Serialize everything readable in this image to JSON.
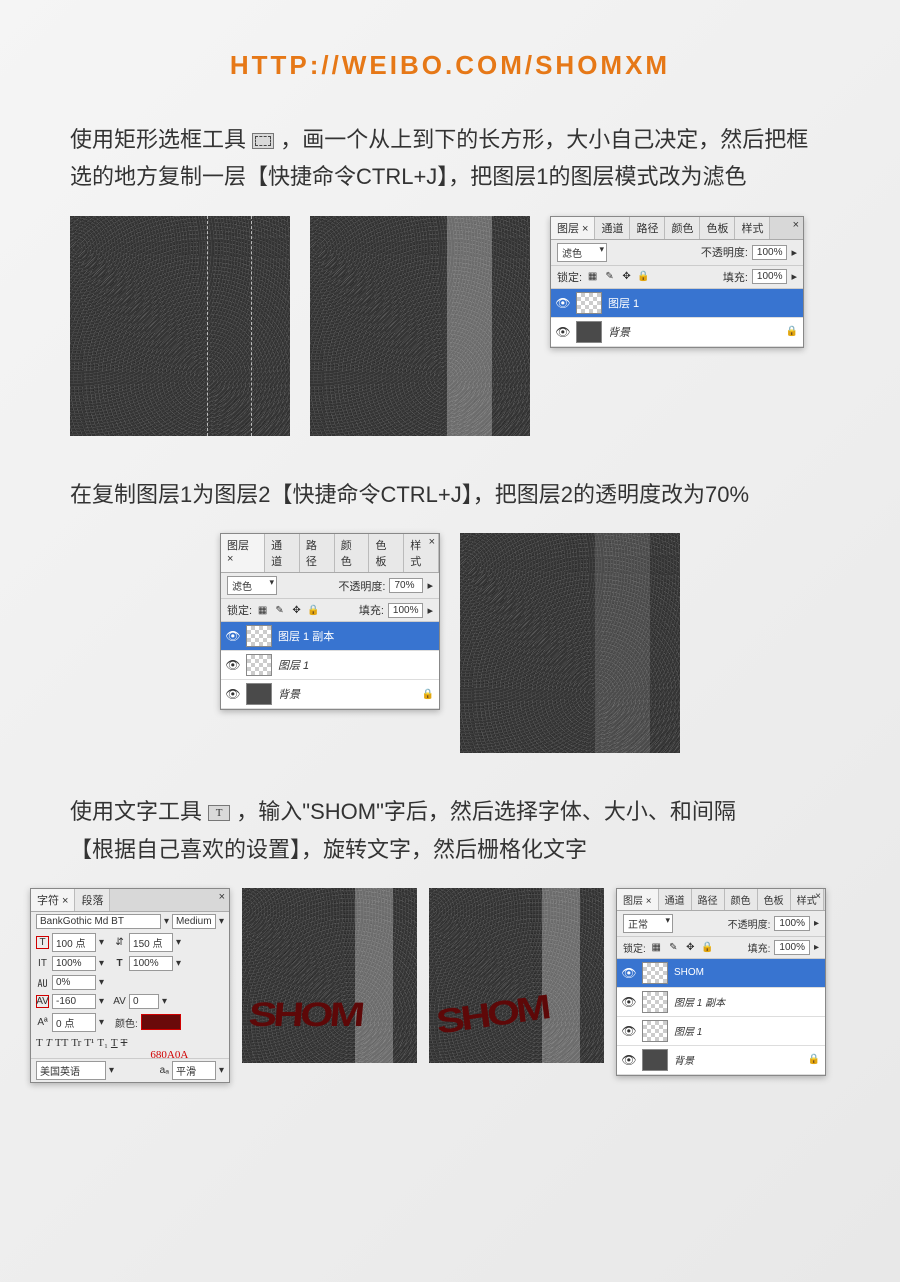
{
  "header": {
    "url": "HTTP://WEIBO.COM/SHOMXM"
  },
  "step1": {
    "text_a": "使用矩形选框工具",
    "text_b": "，画一个从上到下的长方形，大小自己决定，然后把框选的地方复制一层【快捷命令CTRL+J】，把图层1的图层模式改为滤色"
  },
  "panel1": {
    "tabs": [
      "图层 ×",
      "通道",
      "路径",
      "颜色",
      "色板",
      "样式"
    ],
    "blend": "滤色",
    "opacity_label": "不透明度:",
    "opacity_val": "100%",
    "lock_label": "锁定:",
    "fill_label": "填充:",
    "fill_val": "100%",
    "layers": [
      {
        "name": "图层 1",
        "selected": true,
        "thumb": "checker"
      },
      {
        "name": "背景",
        "locked": true,
        "thumb": "noise"
      }
    ]
  },
  "step2": {
    "text": "在复制图层1为图层2【快捷命令CTRL+J】，把图层2的透明度改为70%"
  },
  "panel2": {
    "tabs": [
      "图层 ×",
      "通道",
      "路径",
      "颜色",
      "色板",
      "样式"
    ],
    "blend": "滤色",
    "opacity_label": "不透明度:",
    "opacity_val": "70%",
    "lock_label": "锁定:",
    "fill_label": "填充:",
    "fill_val": "100%",
    "layers": [
      {
        "name": "图层 1 副本",
        "selected": true,
        "thumb": "checker"
      },
      {
        "name": "图层 1",
        "thumb": "checker"
      },
      {
        "name": "背景",
        "locked": true,
        "thumb": "noise"
      }
    ]
  },
  "step3": {
    "text_a": "使用文字工具",
    "text_b": "，输入\"SHOM\"字后，然后选择字体、大小、和间隔",
    "text_c": "【根据自己喜欢的设置】，旋转文字，然后栅格化文字"
  },
  "char_panel": {
    "tabs": [
      "字符 ×",
      "段落"
    ],
    "font": "BankGothic Md BT",
    "weight": "Medium",
    "size": "100 点",
    "leading": "150 点",
    "scale_v": "100%",
    "scale_h": "100%",
    "baseline_pct": "0%",
    "tracking": "-160",
    "baseline_shift": "0 点",
    "color_label": "颜色:",
    "color_hex": "680A0A",
    "lang": "美国英语",
    "aa": "平滑",
    "aa_prefix": "aₐ"
  },
  "shom": "SHOM",
  "panel3": {
    "tabs": [
      "图层 ×",
      "通道",
      "路径",
      "颜色",
      "色板",
      "样式"
    ],
    "blend": "正常",
    "opacity_label": "不透明度:",
    "opacity_val": "100%",
    "lock_label": "锁定:",
    "fill_label": "填充:",
    "fill_val": "100%",
    "layers": [
      {
        "name": "SHOM",
        "selected": true,
        "thumb": "checker"
      },
      {
        "name": "图层 1 副本",
        "thumb": "checker"
      },
      {
        "name": "图层 1",
        "thumb": "checker"
      },
      {
        "name": "背景",
        "locked": true,
        "thumb": "noise"
      }
    ]
  }
}
